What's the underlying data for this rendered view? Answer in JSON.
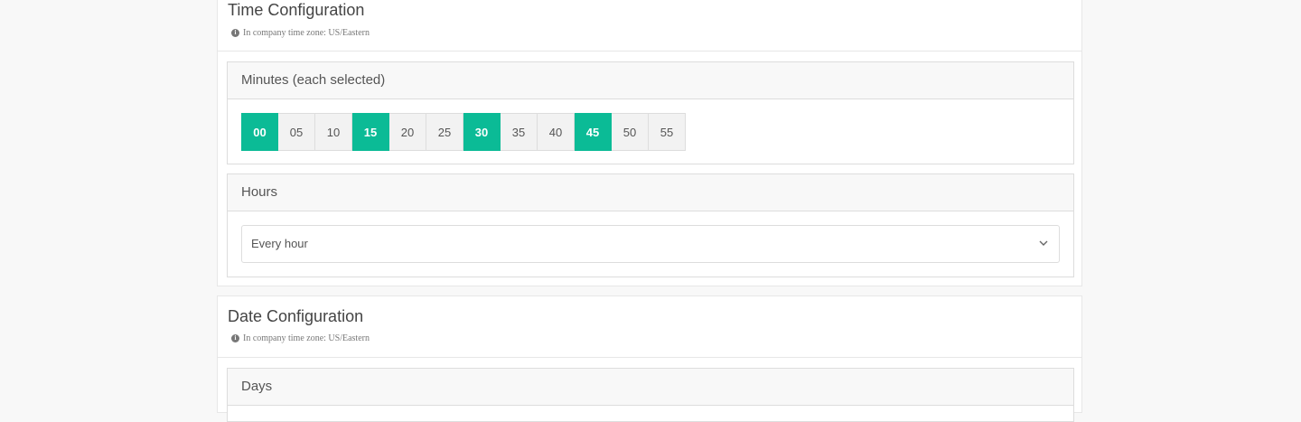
{
  "time_config": {
    "title": "Time Configuration",
    "timezone_note": "In company time zone: US/Eastern",
    "minutes": {
      "label": "Minutes (each selected)",
      "options": [
        {
          "label": "00",
          "selected": true
        },
        {
          "label": "05",
          "selected": false
        },
        {
          "label": "10",
          "selected": false
        },
        {
          "label": "15",
          "selected": true
        },
        {
          "label": "20",
          "selected": false
        },
        {
          "label": "25",
          "selected": false
        },
        {
          "label": "30",
          "selected": true
        },
        {
          "label": "35",
          "selected": false
        },
        {
          "label": "40",
          "selected": false
        },
        {
          "label": "45",
          "selected": true
        },
        {
          "label": "50",
          "selected": false
        },
        {
          "label": "55",
          "selected": false
        }
      ]
    },
    "hours": {
      "label": "Hours",
      "selected_value": "Every hour"
    }
  },
  "date_config": {
    "title": "Date Configuration",
    "timezone_note": "In company time zone: US/Eastern",
    "days": {
      "label": "Days"
    }
  },
  "colors": {
    "accent": "#0bbb96",
    "unselected": "#f2f2f2"
  }
}
